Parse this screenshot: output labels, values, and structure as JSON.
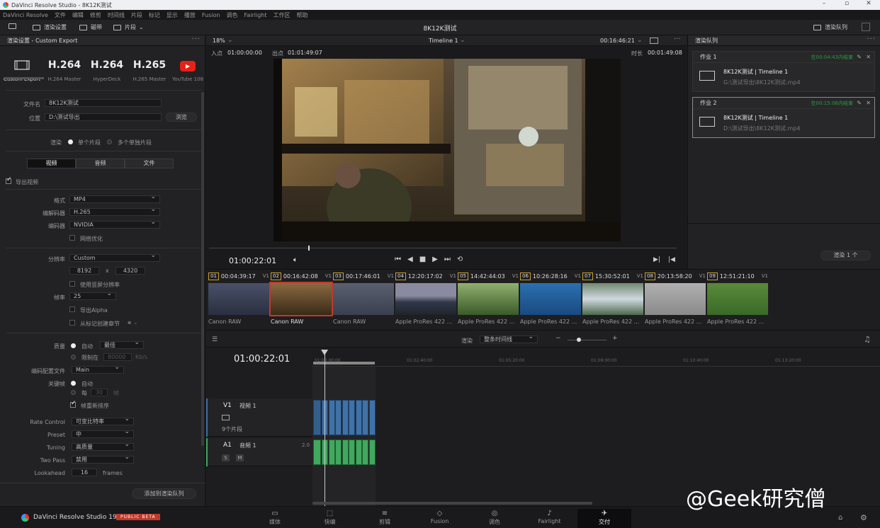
{
  "app": {
    "window_title": "DaVinci Resolve Studio - 8K12K测试",
    "project_title": "8K12K测试",
    "product": "DaVinci Resolve Studio 19",
    "beta_badge": "PUBLIC BETA"
  },
  "menu": [
    "DaVinci Resolve",
    "文件",
    "编辑",
    "修剪",
    "时间线",
    "片段",
    "标记",
    "显示",
    "播放",
    "Fusion",
    "调色",
    "Fairlight",
    "工作区",
    "帮助"
  ],
  "toolbar": {
    "render_settings": "渲染设置",
    "tape": "磁带",
    "clips": "片段",
    "render_queue": "渲染队列"
  },
  "left_panel": {
    "title": "渲染设置 - Custom Export",
    "presets": [
      {
        "big": "",
        "label": "Custom Export"
      },
      {
        "big": "H.264",
        "label": "H.264 Master"
      },
      {
        "big": "H.264",
        "label": "HyperDeck"
      },
      {
        "big": "H.265",
        "label": "H.265 Master"
      },
      {
        "big": "",
        "label": "YouTube 108"
      }
    ],
    "filename_label": "文件名",
    "filename": "8K12K测试",
    "location_label": "位置",
    "location": "D:\\测试导出",
    "browse": "浏览",
    "render_label": "渲染",
    "single_clip": "单个片段",
    "multi_clip": "多个单独片段",
    "tabs": [
      "视频",
      "音频",
      "文件"
    ],
    "export_video": "导出视频",
    "format_label": "格式",
    "format": "MP4",
    "codec_label": "编解码器",
    "codec": "H.265",
    "encoder_label": "编码器",
    "encoder": "NVIDIA",
    "net_opt": "网络优化",
    "res_label": "分辨率",
    "resolution": "Custom",
    "width": "8192",
    "x": "x",
    "height": "4320",
    "vertical_res": "使用竖屏分辨率",
    "fps_label": "帧率",
    "fps": "25",
    "alpha": "导出Alpha",
    "chapters": "从标记创建章节",
    "quality_label": "质量",
    "auto": "自动",
    "best": "最佳",
    "limit": "限制在",
    "limit_val": "80000",
    "kbs": "Kb/s",
    "profile_label": "编码配置文件",
    "profile": "Main",
    "keyframe_label": "关键帧",
    "kf_auto": "自动",
    "kf_every": "每",
    "kf_val": "30",
    "kf_unit": "帧",
    "reorder": "帧重新排序",
    "rate_label": "Rate Control",
    "rate": "可变比特率",
    "preset_label": "Preset",
    "preset": "中",
    "tuning_label": "Tuning",
    "tuning": "高质量",
    "twopass_label": "Two Pass",
    "twopass": "禁用",
    "lookahead_label": "Lookahead",
    "lookahead": "16",
    "frames": "frames",
    "add_queue": "添加到渲染队列"
  },
  "viewer": {
    "zoom": "18%",
    "timeline": "Timeline 1",
    "tc_top": "00:16:46:21",
    "in_label": "入点",
    "in_tc": "01:00:00:00",
    "out_label": "出点",
    "out_tc": "01:01:49:07",
    "dur_label": "时长",
    "dur_tc": "00:01:49:08",
    "current_tc": "01:00:22:01"
  },
  "queue": {
    "title": "渲染队列",
    "jobs": [
      {
        "name": "作业 1",
        "status": "在00:04:43内结束",
        "title": "8K12K测试 | Timeline 1",
        "path": "G:\\测试导出\\8K12K测试.mp4"
      },
      {
        "name": "作业 2",
        "status": "在00:15:06内结束",
        "title": "8K12K测试 | Timeline 1",
        "path": "D:\\测试导出\\8K12K测试.mp4"
      }
    ],
    "render_btn": "渲染 1 个"
  },
  "clips": [
    {
      "num": "01",
      "tc": "00:04:39:17",
      "track": "V1",
      "name": "Canon RAW"
    },
    {
      "num": "02",
      "tc": "00:16:42:08",
      "track": "V1",
      "name": "Canon RAW"
    },
    {
      "num": "03",
      "tc": "00:17:46:01",
      "track": "V1",
      "name": "Canon RAW"
    },
    {
      "num": "04",
      "tc": "12:20:17:02",
      "track": "V1",
      "name": "Apple ProRes 422 ..."
    },
    {
      "num": "05",
      "tc": "14:42:44:03",
      "track": "V1",
      "name": "Apple ProRes 422 ..."
    },
    {
      "num": "06",
      "tc": "10:26:28:16",
      "track": "V1",
      "name": "Apple ProRes 422 ..."
    },
    {
      "num": "07",
      "tc": "15:30:52:01",
      "track": "V1",
      "name": "Apple ProRes 422 ..."
    },
    {
      "num": "08",
      "tc": "20:13:58:20",
      "track": "V1",
      "name": "Apple ProRes 422 ..."
    },
    {
      "num": "09",
      "tc": "12:51:21:10",
      "track": "V1",
      "name": "Apple ProRes 422 ..."
    }
  ],
  "timeline": {
    "render_label": "渲染",
    "render_mode": "整条时间线",
    "current_tc": "01:00:22:01",
    "ruler": [
      "01:00:00:00",
      "01:02:40:00",
      "01:05:20:00",
      "01:08:00:00",
      "01:10:40:00",
      "01:13:20:00"
    ],
    "v1": "V1",
    "v1_name": "视频 1",
    "v1_count": "9个片段",
    "a1": "A1",
    "a1_name": "音频 1",
    "a1_ch": "2.0",
    "s": "S",
    "m": "M"
  },
  "pages": [
    "媒体",
    "快编",
    "剪辑",
    "Fusion",
    "调色",
    "Fairlight",
    "交付"
  ],
  "active_page": "交付",
  "watermark": "@Geek研究僧",
  "colors": {
    "accent_red": "#c0392b",
    "status_green": "#2c9a3c",
    "clip_blue": "#3a6ea5",
    "audio_green": "#3aa65a"
  }
}
